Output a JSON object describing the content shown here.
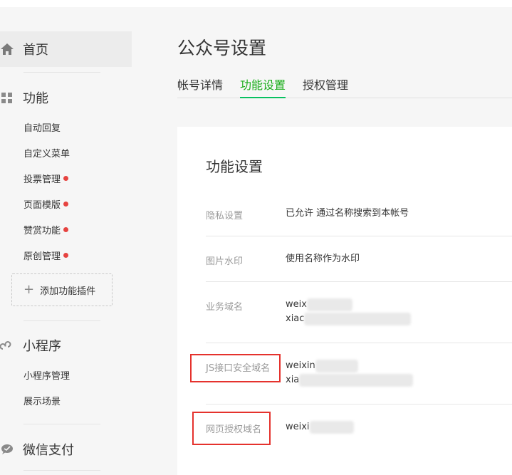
{
  "sidebar": {
    "home": {
      "label": "首页",
      "icon": "home-icon"
    },
    "function": {
      "label": "功能",
      "icon": "grid-icon",
      "items": [
        {
          "label": "自动回复",
          "badge": false
        },
        {
          "label": "自定义菜单",
          "badge": false
        },
        {
          "label": "投票管理",
          "badge": true
        },
        {
          "label": "页面模版",
          "badge": true
        },
        {
          "label": "赞赏功能",
          "badge": true
        },
        {
          "label": "原创管理",
          "badge": true
        }
      ],
      "add_plugin": "添加功能插件"
    },
    "miniprogram": {
      "label": "小程序",
      "icon": "miniprogram-icon",
      "items": [
        {
          "label": "小程序管理"
        },
        {
          "label": "展示场景"
        }
      ]
    },
    "pay": {
      "label": "微信支付",
      "icon": "wechat-pay-icon"
    }
  },
  "header": {
    "title": "公众号设置",
    "tabs": [
      {
        "label": "帐号详情",
        "active": false
      },
      {
        "label": "功能设置",
        "active": true
      },
      {
        "label": "授权管理",
        "active": false
      }
    ]
  },
  "card": {
    "title": "功能设置",
    "rows": [
      {
        "label": "隐私设置",
        "values": [
          "已允许 通过名称搜索到本帐号"
        ]
      },
      {
        "label": "图片水印",
        "values": [
          "使用名称作为水印"
        ]
      },
      {
        "label": "业务域名",
        "values": [
          "weix",
          "xiac"
        ]
      },
      {
        "label": "JS接口安全域名",
        "values": [
          "weixin",
          "xia"
        ]
      },
      {
        "label": "网页授权域名",
        "values": [
          "weixi"
        ]
      }
    ]
  },
  "colors": {
    "accent": "#1aad19",
    "badge": "#e64340",
    "highlight": "#e5322d"
  }
}
